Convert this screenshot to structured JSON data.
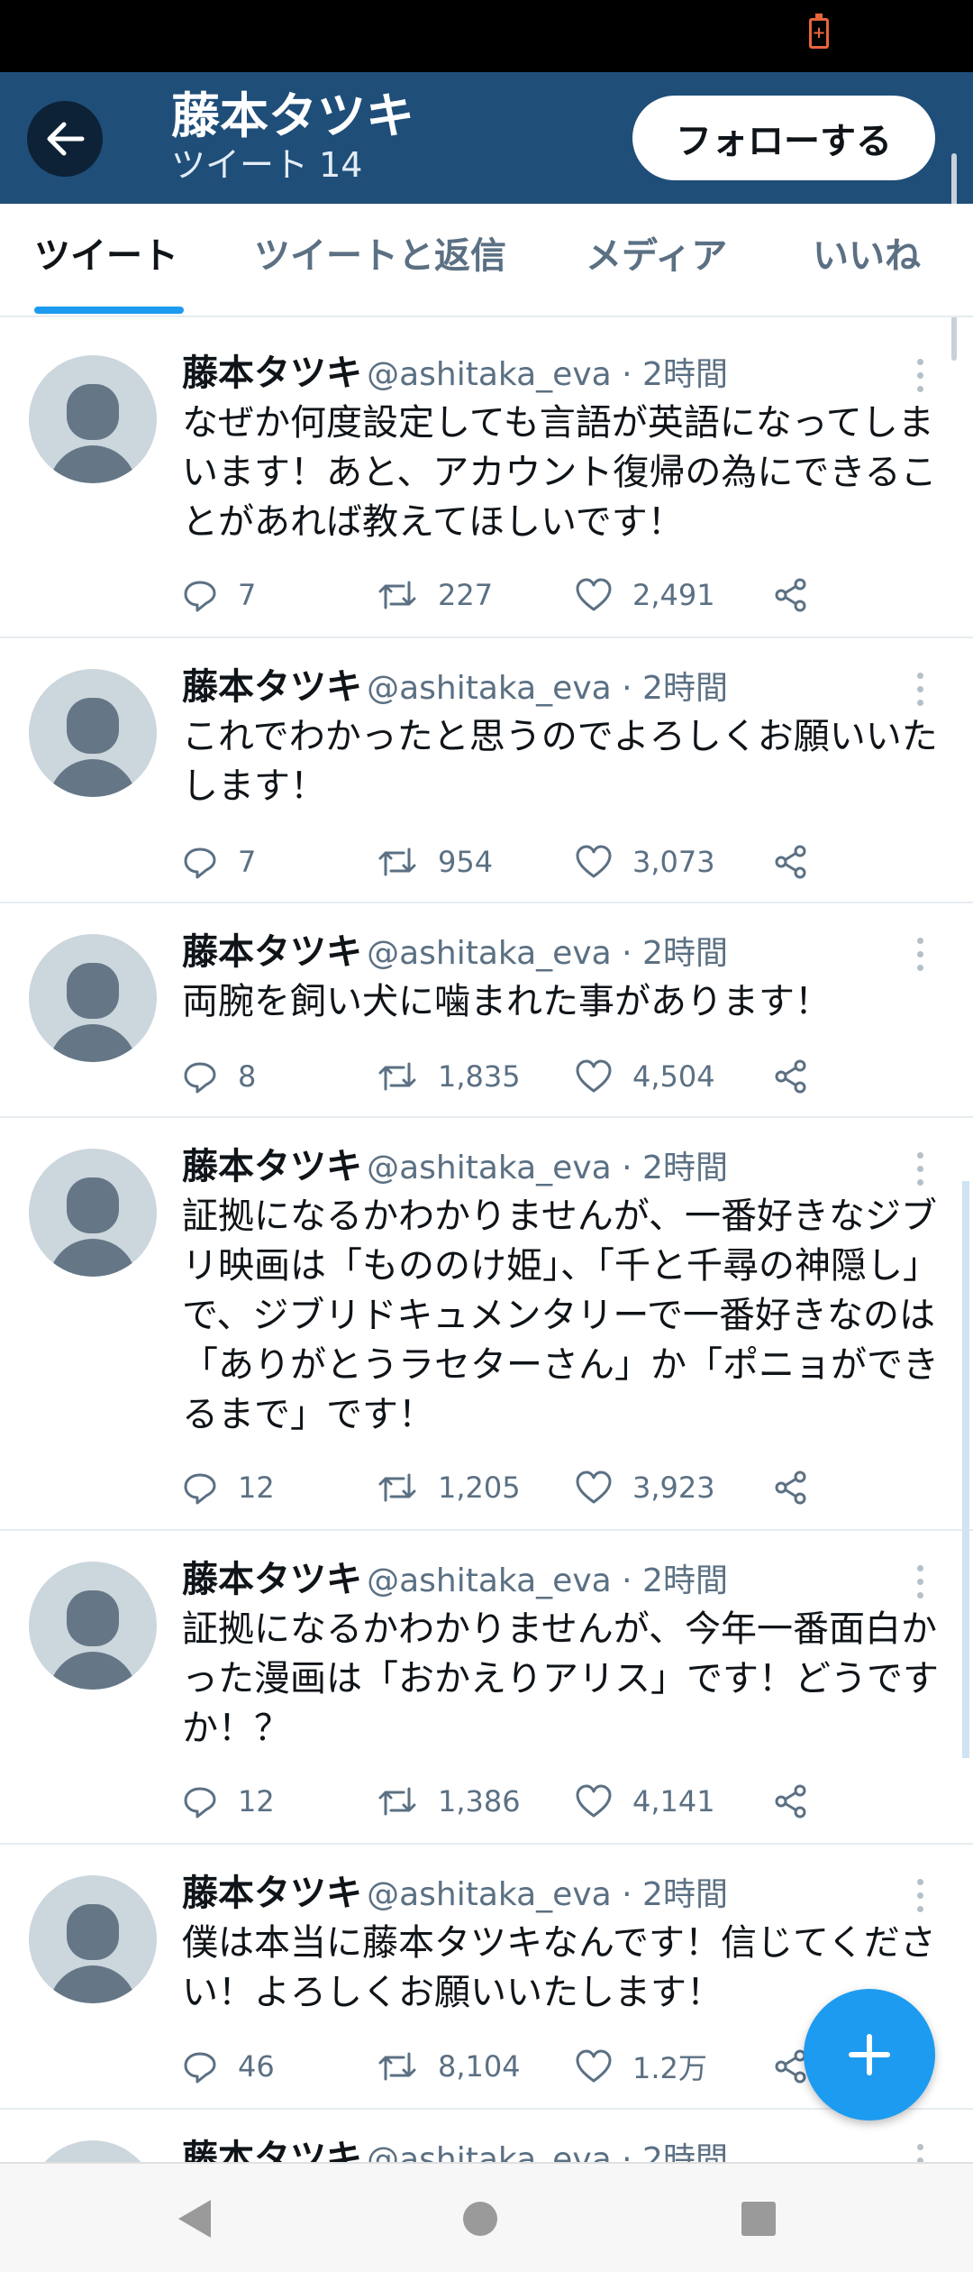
{
  "status_bar": {
    "battery_icon": "battery-charging-icon",
    "battery_color": "#e8653a"
  },
  "header": {
    "back_icon": "arrow-left-icon",
    "title": "藤本タツキ",
    "subtitle": "ツイート 14",
    "follow_label": "フォローする",
    "bg_color": "#1f4e79"
  },
  "tabs": [
    {
      "label": "ツイート",
      "active": true
    },
    {
      "label": "ツイートと返信",
      "active": false
    },
    {
      "label": "メディア",
      "active": false
    },
    {
      "label": "いいね",
      "active": false
    }
  ],
  "tweets": [
    {
      "name": "藤本タツキ",
      "handle": "@ashitaka_eva",
      "time": "2時間",
      "text": "なぜか何度設定しても言語が英語になってしまいます！あと、アカウント復帰の為にできることがあれば教えてほしいです！",
      "replies": "7",
      "retweets": "227",
      "likes": "2,491"
    },
    {
      "name": "藤本タツキ",
      "handle": "@ashitaka_eva",
      "time": "2時間",
      "text": "これでわかったと思うのでよろしくお願いいたします！",
      "replies": "7",
      "retweets": "954",
      "likes": "3,073"
    },
    {
      "name": "藤本タツキ",
      "handle": "@ashitaka_eva",
      "time": "2時間",
      "text": "両腕を飼い犬に噛まれた事があります！",
      "replies": "8",
      "retweets": "1,835",
      "likes": "4,504"
    },
    {
      "name": "藤本タツキ",
      "handle": "@ashitaka_eva",
      "time": "2時間",
      "text": "証拠になるかわかりませんが、一番好きなジブリ映画は「もののけ姫」、「千と千尋の神隠し」で、ジブリドキュメンタリーで一番好きなのは「ありがとうラセターさん」か「ポニョができるまで」です！",
      "replies": "12",
      "retweets": "1,205",
      "likes": "3,923"
    },
    {
      "name": "藤本タツキ",
      "handle": "@ashitaka_eva",
      "time": "2時間",
      "text": "証拠になるかわかりませんが、今年一番面白かった漫画は「おかえりアリス」です！どうですか！？",
      "replies": "12",
      "retweets": "1,386",
      "likes": "4,141"
    },
    {
      "name": "藤本タツキ",
      "handle": "@ashitaka_eva",
      "time": "2時間",
      "text": "僕は本当に藤本タツキなんです！信じてください！よろしくお願いいたします！",
      "replies": "46",
      "retweets": "8,104",
      "likes": "1.2万"
    },
    {
      "name": "藤本タツキ",
      "handle": "@ashitaka_eva",
      "time": "2時間",
      "text": "",
      "replies": "",
      "retweets": "",
      "likes": ""
    }
  ],
  "fab": {
    "icon": "plus-icon",
    "color": "#1d9bf0"
  },
  "nav_bar": {
    "back_icon": "nav-back-icon",
    "home_icon": "nav-home-icon",
    "recents_icon": "nav-recents-icon"
  }
}
